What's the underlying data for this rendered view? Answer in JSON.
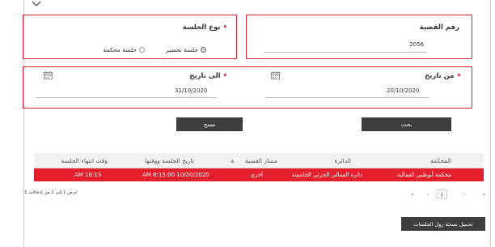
{
  "top": {
    "collapse_icon": "chevron-down-icon"
  },
  "case_number": {
    "label": "رقم القضية",
    "value": "2056"
  },
  "session_type": {
    "label": "نوع الجلسة",
    "options": [
      {
        "label": "جلسة تحضير",
        "selected": true
      },
      {
        "label": "جلسة محكمة",
        "selected": false
      }
    ]
  },
  "date_from": {
    "label": "من تاريخ",
    "value": "20/10/2020",
    "icon": "calendar-icon"
  },
  "date_to": {
    "label": "الى تاريخ",
    "value": "31/10/2020",
    "icon": "calendar-icon"
  },
  "buttons": {
    "search": "بحث",
    "clear": "مسح",
    "download": "تحميل نسخة رول الجلسات"
  },
  "table": {
    "columns": [
      "المحكمة",
      "الدائرة",
      "مسار القضية",
      "تاريخ الجلسة ووقتها",
      "وقت انتهاء الجلسة"
    ],
    "rows": [
      {
        "court": "محكمة أبوظبي العمالية",
        "circuit": "دائرة العمالي الجزئي الخامسة",
        "track": "أخرى",
        "datetime": "AM 8:15:00 10/20/2020",
        "end_time": "AM 10:15"
      }
    ]
  },
  "pagination": {
    "info": "عرض 1 إلى 1 من إدخالات 1",
    "current_page": "1",
    "first": "«",
    "prev": "‹",
    "next": "›",
    "last": "»"
  },
  "colors": {
    "accent": "#e5202d",
    "border_highlight": "#d9232e",
    "button": "#3d3d3d"
  }
}
